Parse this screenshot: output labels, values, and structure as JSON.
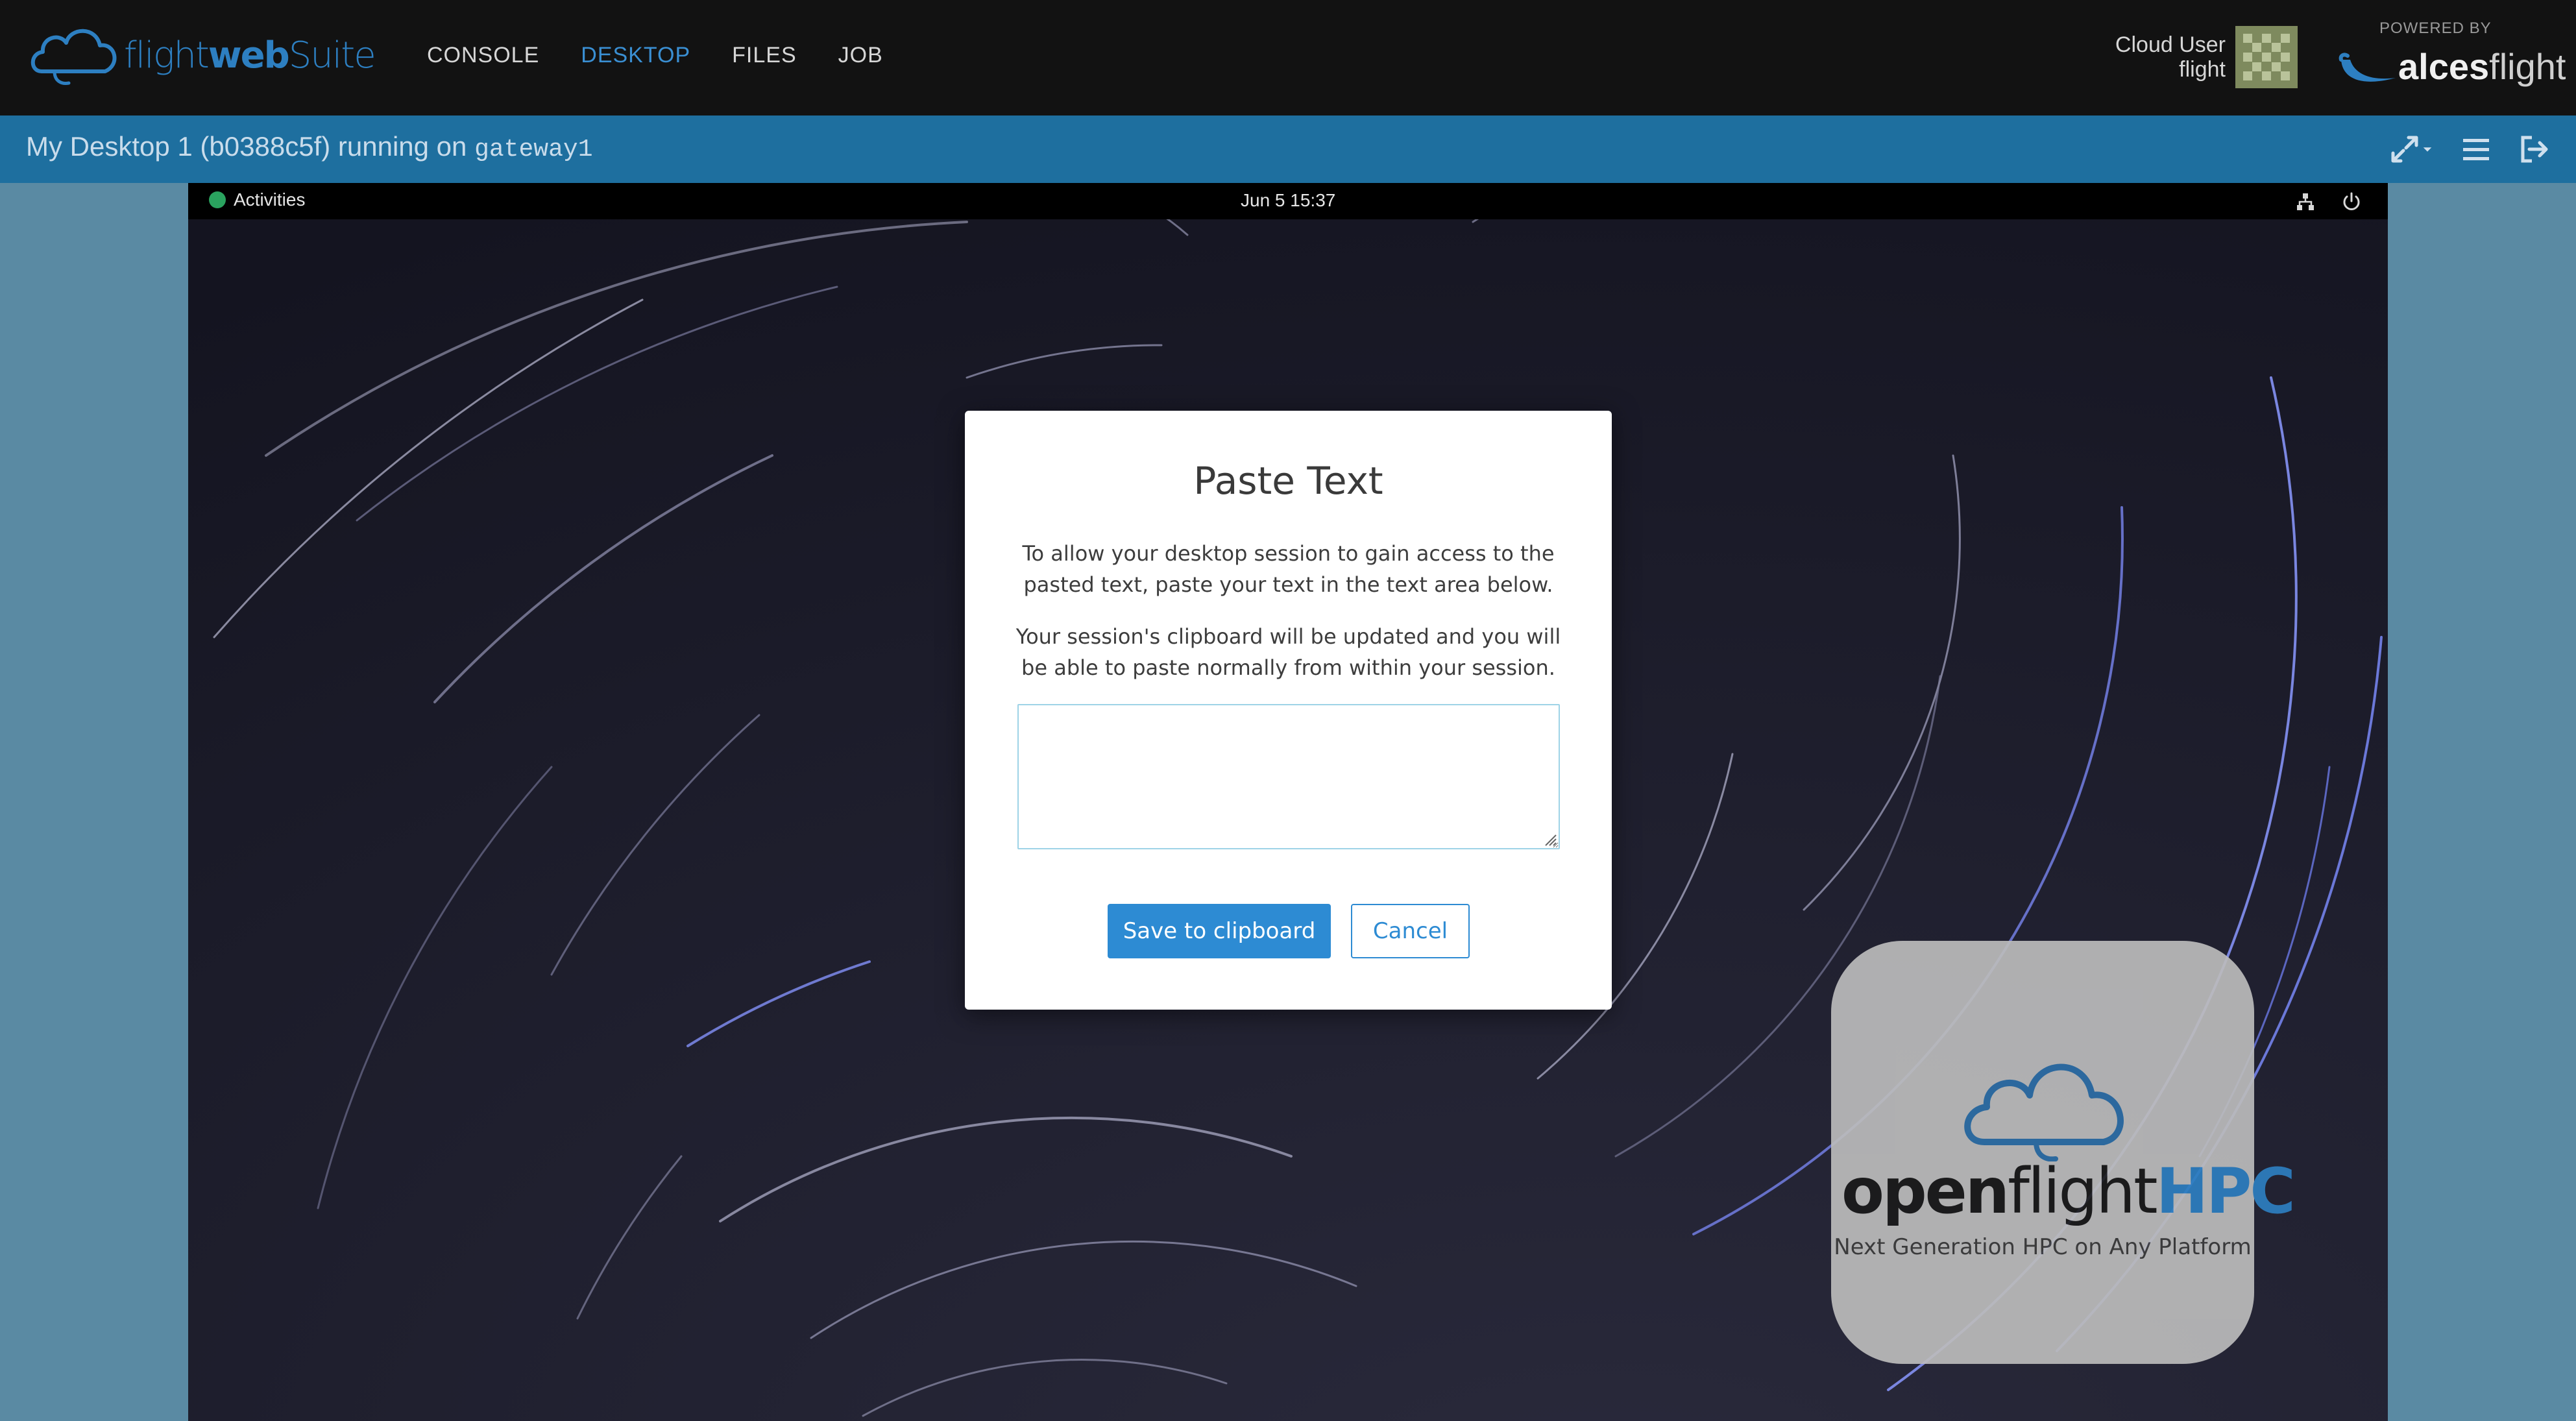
{
  "brand": {
    "prefix": "flight",
    "middle": "web",
    "suffix": "Suite",
    "icon": "cloud-logo-icon"
  },
  "nav": {
    "items": [
      {
        "label": "CONSOLE",
        "active": false
      },
      {
        "label": "DESKTOP",
        "active": true
      },
      {
        "label": "FILES",
        "active": false
      },
      {
        "label": "JOB",
        "active": false
      }
    ]
  },
  "user": {
    "name": "Cloud User",
    "username": "flight"
  },
  "powered_by": {
    "label": "POWERED BY",
    "brand_light": "alces",
    "brand_bold": "flight"
  },
  "session": {
    "title": "My Desktop 1 (b0388c5f) running on ",
    "host": "gateway1",
    "icons": [
      "expand-icon",
      "menu-icon",
      "logout-icon"
    ]
  },
  "desktop": {
    "activities": "Activities",
    "clock": "Jun 5  15:37",
    "tray_icons": [
      "network-icon",
      "power-icon"
    ]
  },
  "logo_tile": {
    "word_bold": "open",
    "word_mid": "flight",
    "word_accent": "HPC",
    "tagline": "Next Generation HPC on Any Platform"
  },
  "modal": {
    "title": "Paste Text",
    "paragraph1": "To allow your desktop session to gain access to the pasted text, paste your text in the text area below.",
    "paragraph2": "Your session's clipboard will be updated and you will be able to paste normally from within your session.",
    "textarea_value": "",
    "save_label": "Save to clipboard",
    "cancel_label": "Cancel"
  },
  "colors": {
    "navbar": "#121212",
    "session_bar": "#1e6f9f",
    "accent": "#2d8bd3",
    "active_nav": "#3a8fd3"
  }
}
